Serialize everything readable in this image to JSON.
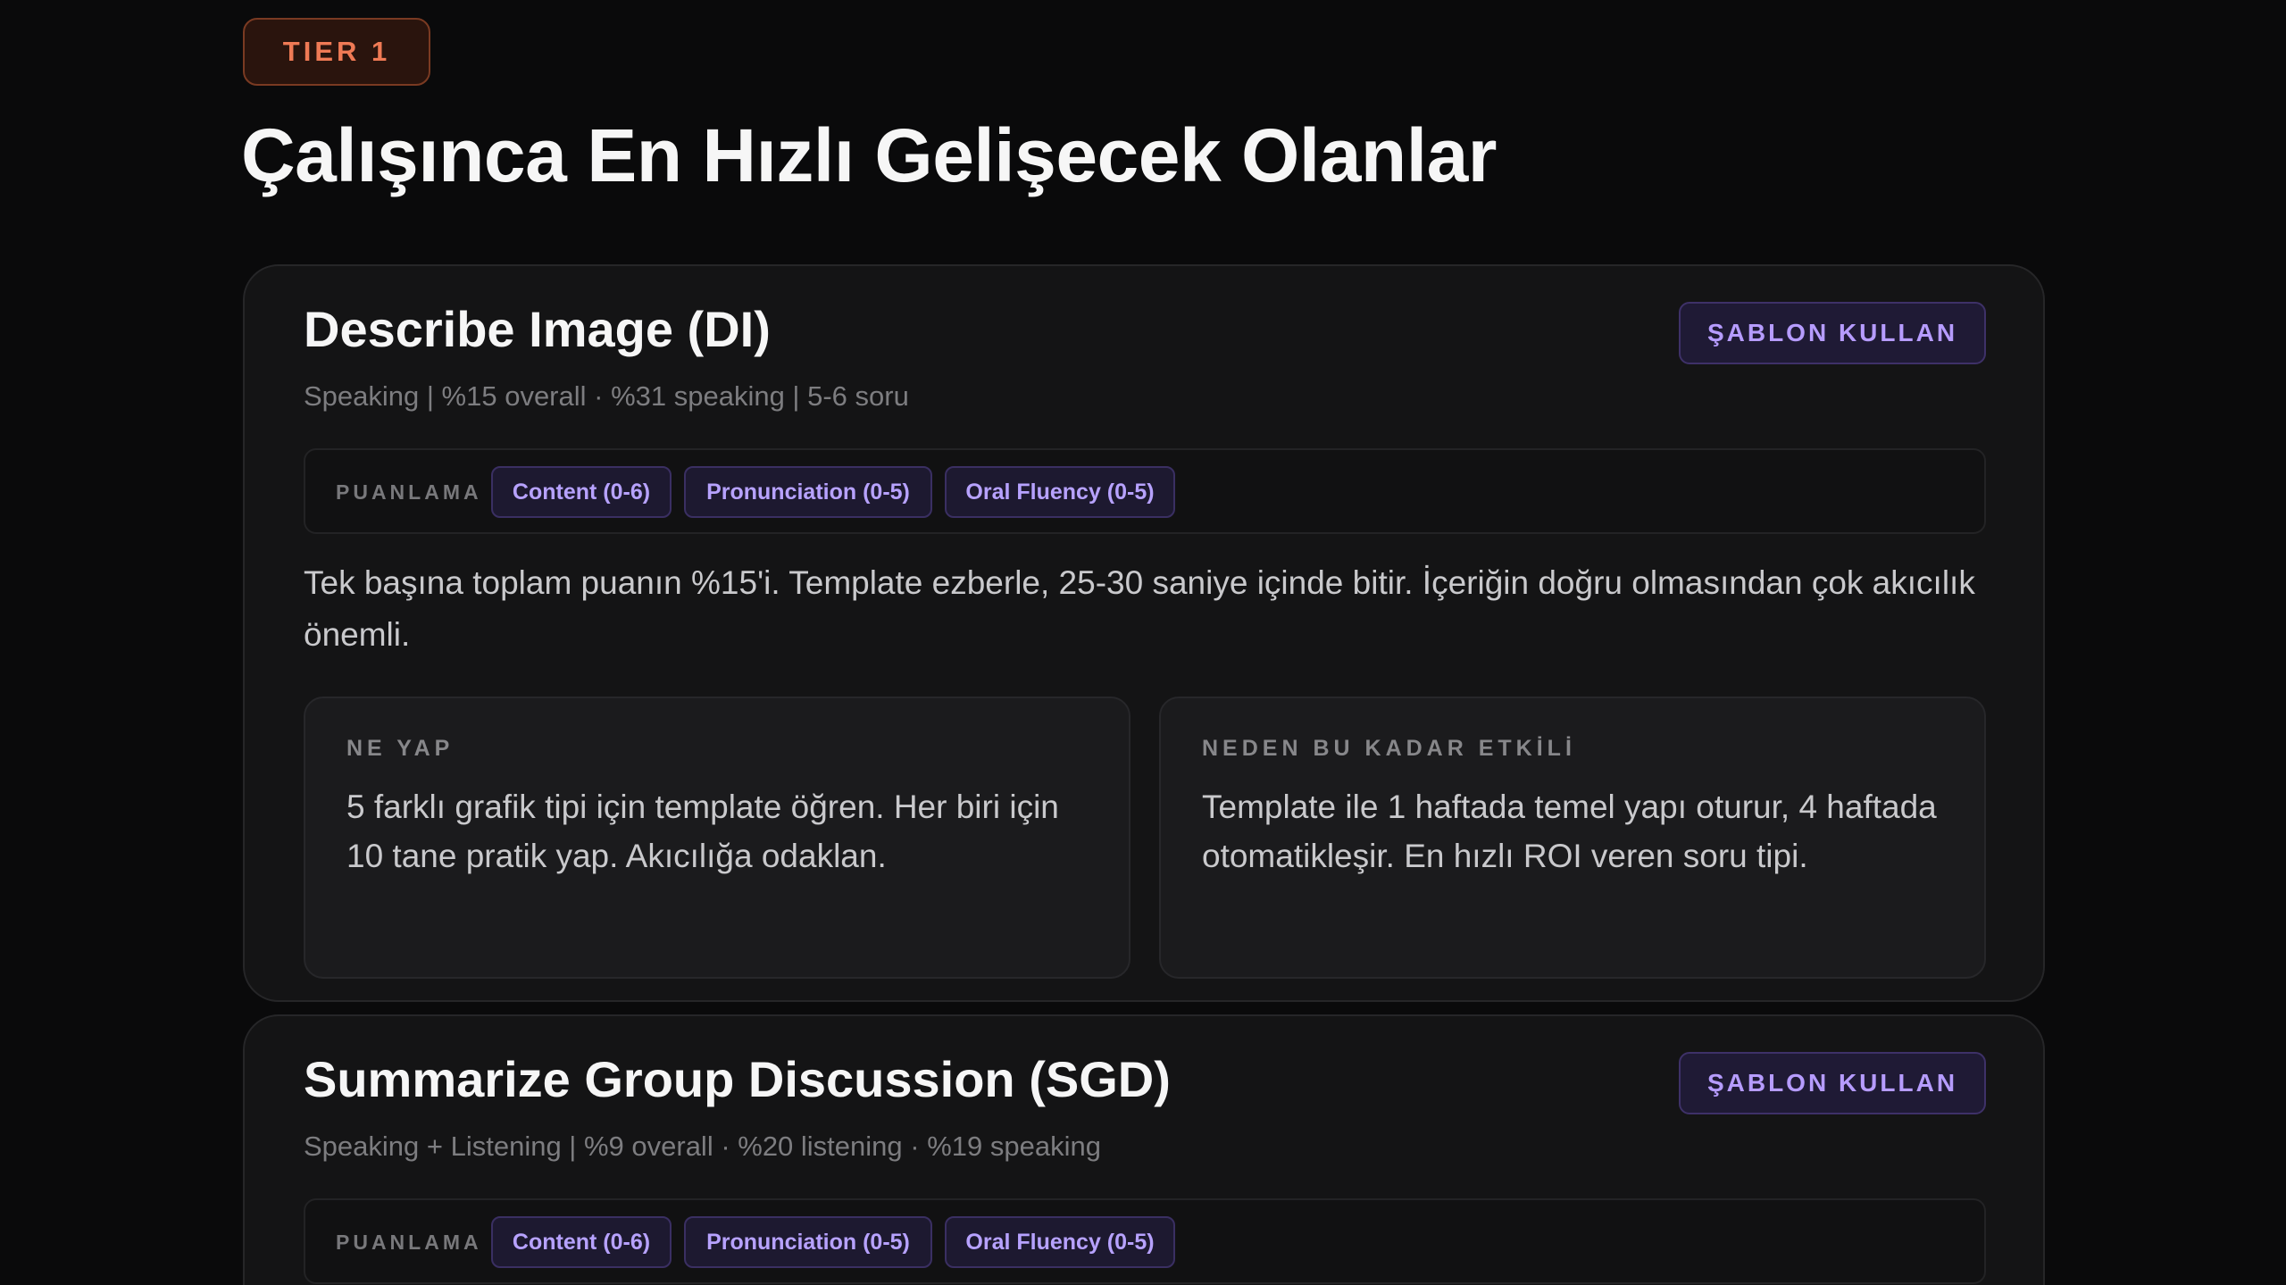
{
  "tier_badge": "TIER 1",
  "page_title": "Çalışınca En Hızlı Gelişecek Olanlar",
  "cards": [
    {
      "title": "Describe Image (DI)",
      "button_label": "ŞABLON KULLAN",
      "meta": "Speaking | %15 overall · %31 speaking | 5-6 soru",
      "scoring_label": "PUANLAMA",
      "scoring_chips": [
        "Content (0-6)",
        "Pronunciation (0-5)",
        "Oral Fluency (0-5)"
      ],
      "description": "Tek başına toplam puanın %15'i. Template ezberle, 25-30 saniye içinde bitir. İçeriğin doğru olmasından çok akıcılık önemli.",
      "what_to_do": {
        "heading": "NE YAP",
        "text": "5 farklı grafik tipi için template öğren. Her biri için 10 tane pratik yap. Akıcılığa odaklan."
      },
      "why_effective": {
        "heading": "NEDEN BU KADAR ETKİLİ",
        "text": "Template ile 1 haftada temel yapı oturur, 4 haftada otomatikleşir. En hızlı ROI veren soru tipi."
      }
    },
    {
      "title": "Summarize Group Discussion (SGD)",
      "button_label": "ŞABLON KULLAN",
      "meta": "Speaking + Listening | %9 overall · %20 listening · %19 speaking",
      "scoring_label": "PUANLAMA",
      "scoring_chips": [
        "Content (0-6)",
        "Pronunciation (0-5)",
        "Oral Fluency (0-5)"
      ]
    }
  ]
}
